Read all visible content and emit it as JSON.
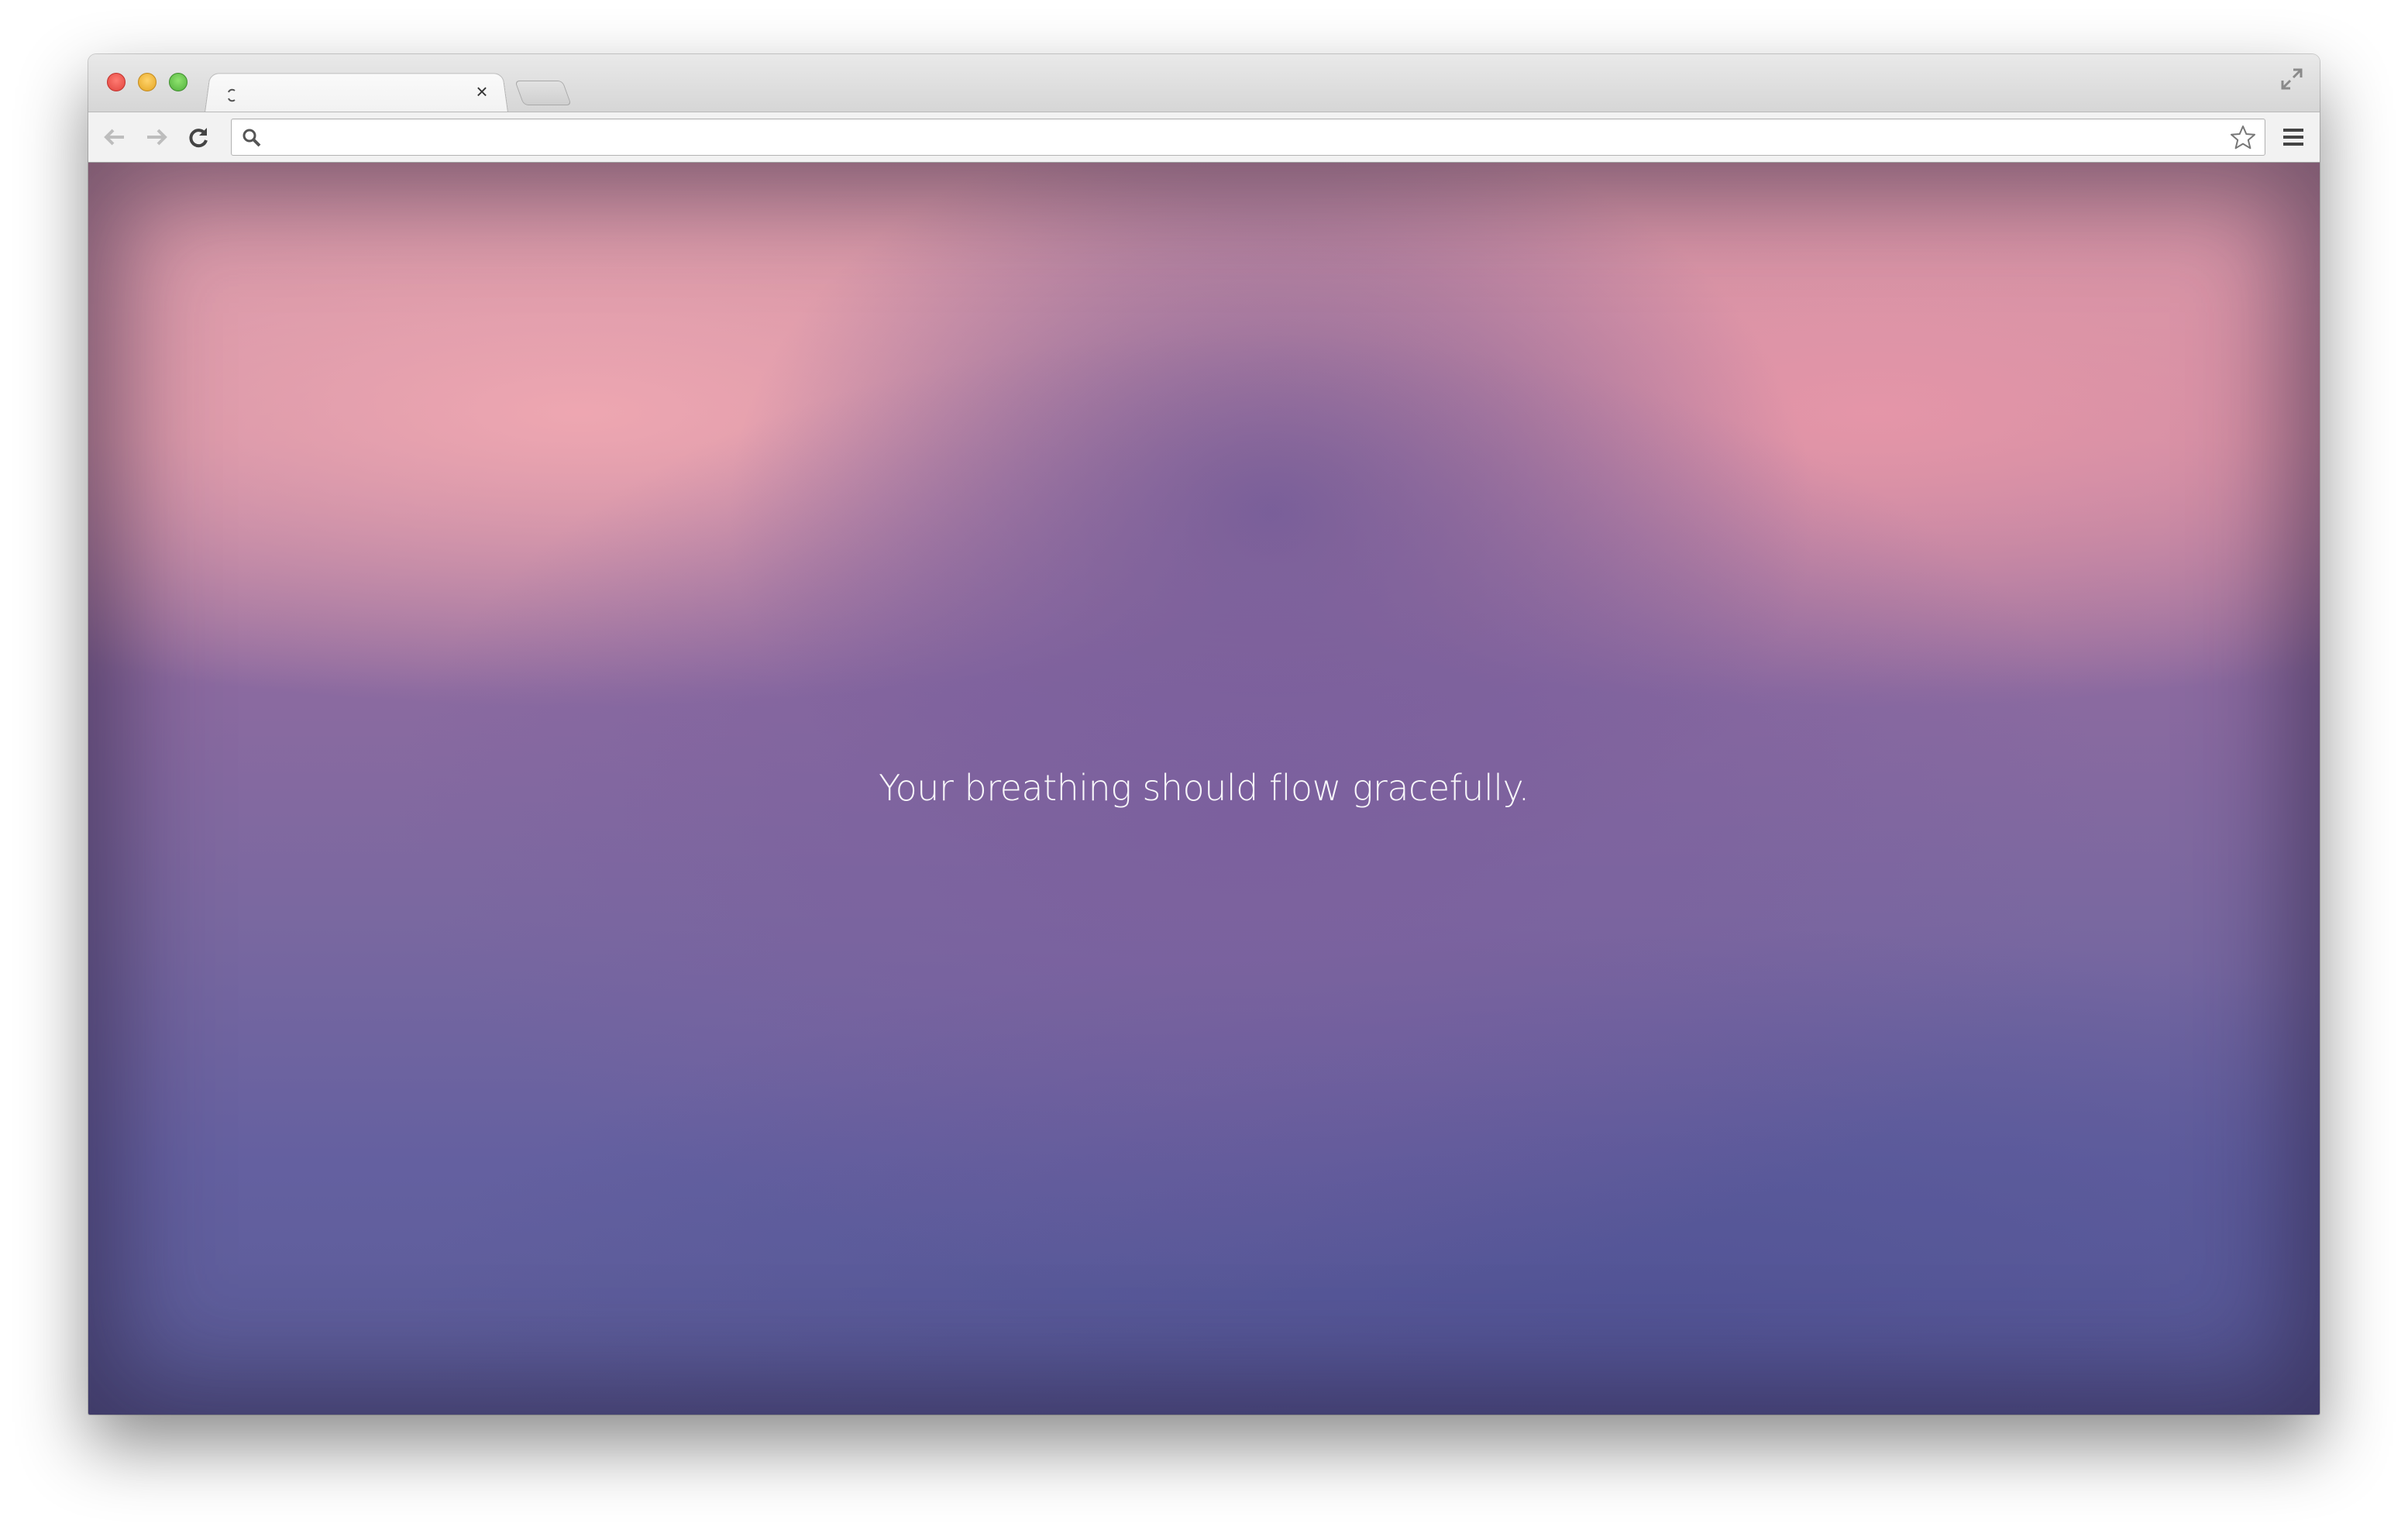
{
  "browser": {
    "tab": {
      "title": "",
      "close_symbol": "×"
    },
    "toolbar": {
      "address_value": "",
      "address_placeholder": ""
    }
  },
  "page": {
    "message": "Your breathing should flow gracefully."
  },
  "icons": {
    "back": "back-arrow-icon",
    "forward": "forward-arrow-icon",
    "reload": "reload-icon",
    "search": "search-icon",
    "star": "star-icon",
    "menu": "hamburger-menu-icon",
    "fullscreen": "fullscreen-icon",
    "loading": "loading-spinner-icon"
  },
  "colors": {
    "close_light": "#ff5f57",
    "minimize_light": "#ffbd2e",
    "zoom_light": "#28c940",
    "gradient_top": "#eea8b2",
    "gradient_middle": "#7f68a0",
    "gradient_bottom": "#55559a",
    "message_text": "#ffffff"
  }
}
